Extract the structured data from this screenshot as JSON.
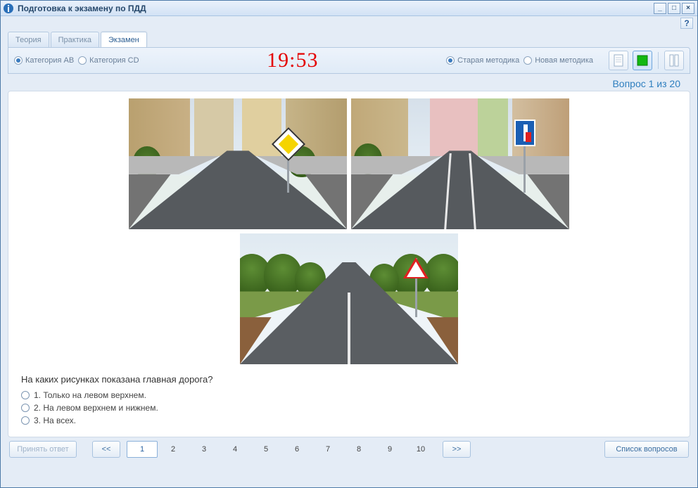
{
  "window": {
    "title": "Подготовка к экзамену по ПДД"
  },
  "tabs": {
    "t0": "Теория",
    "t1": "Практика",
    "t2": "Экзамен"
  },
  "toolbar": {
    "catAB": "Категория AB",
    "catCD": "Категория CD",
    "timer": "19:53",
    "oldMethod": "Старая методика",
    "newMethod": "Новая методика"
  },
  "counter": "Вопрос 1 из 20",
  "scenes": {
    "sign1": "priority-road-diamond",
    "sign2": "no-through-road-blue",
    "sign3": "crossroads-warning-triangle"
  },
  "question": "На каких рисунках показана главная дорога?",
  "answers": {
    "a1": "1. Только на левом верхнем.",
    "a2": "2. На левом верхнем и нижнем.",
    "a3": "3. На всех."
  },
  "pager": {
    "accept": "Принять ответ",
    "prev": "<<",
    "next": ">>",
    "list": "Список вопросов",
    "nums": {
      "n1": "1",
      "n2": "2",
      "n3": "3",
      "n4": "4",
      "n5": "5",
      "n6": "6",
      "n7": "7",
      "n8": "8",
      "n9": "9",
      "n10": "10"
    }
  }
}
